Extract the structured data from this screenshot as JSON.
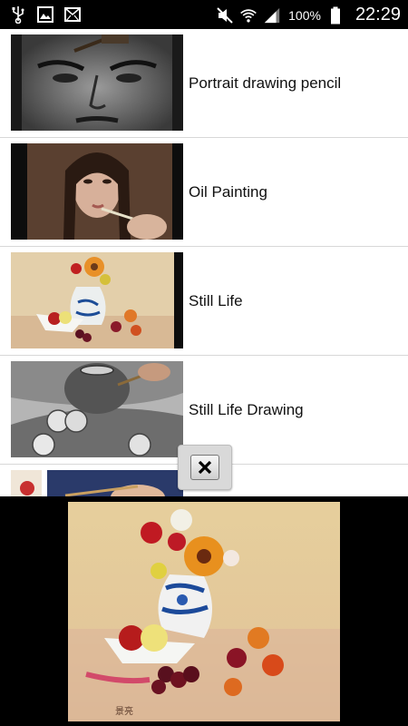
{
  "status_bar": {
    "battery": "100%",
    "time": "22:29",
    "icons": [
      "usb-icon",
      "image-icon",
      "mail-icon",
      "mute-icon",
      "wifi-icon",
      "signal-icon",
      "battery-icon"
    ]
  },
  "videos": [
    {
      "title": "Portrait drawing pencil"
    },
    {
      "title": "Oil Painting"
    },
    {
      "title": "Still Life"
    },
    {
      "title": "Still Life Drawing"
    },
    {
      "title": ""
    }
  ],
  "ad": {
    "close_icon": "close-icon",
    "signature": "景亮"
  },
  "colors": {
    "status_bar_bg": "#000000",
    "list_bg": "#ffffff",
    "divider": "#d8d8d8",
    "ad_bg": "#000000"
  }
}
